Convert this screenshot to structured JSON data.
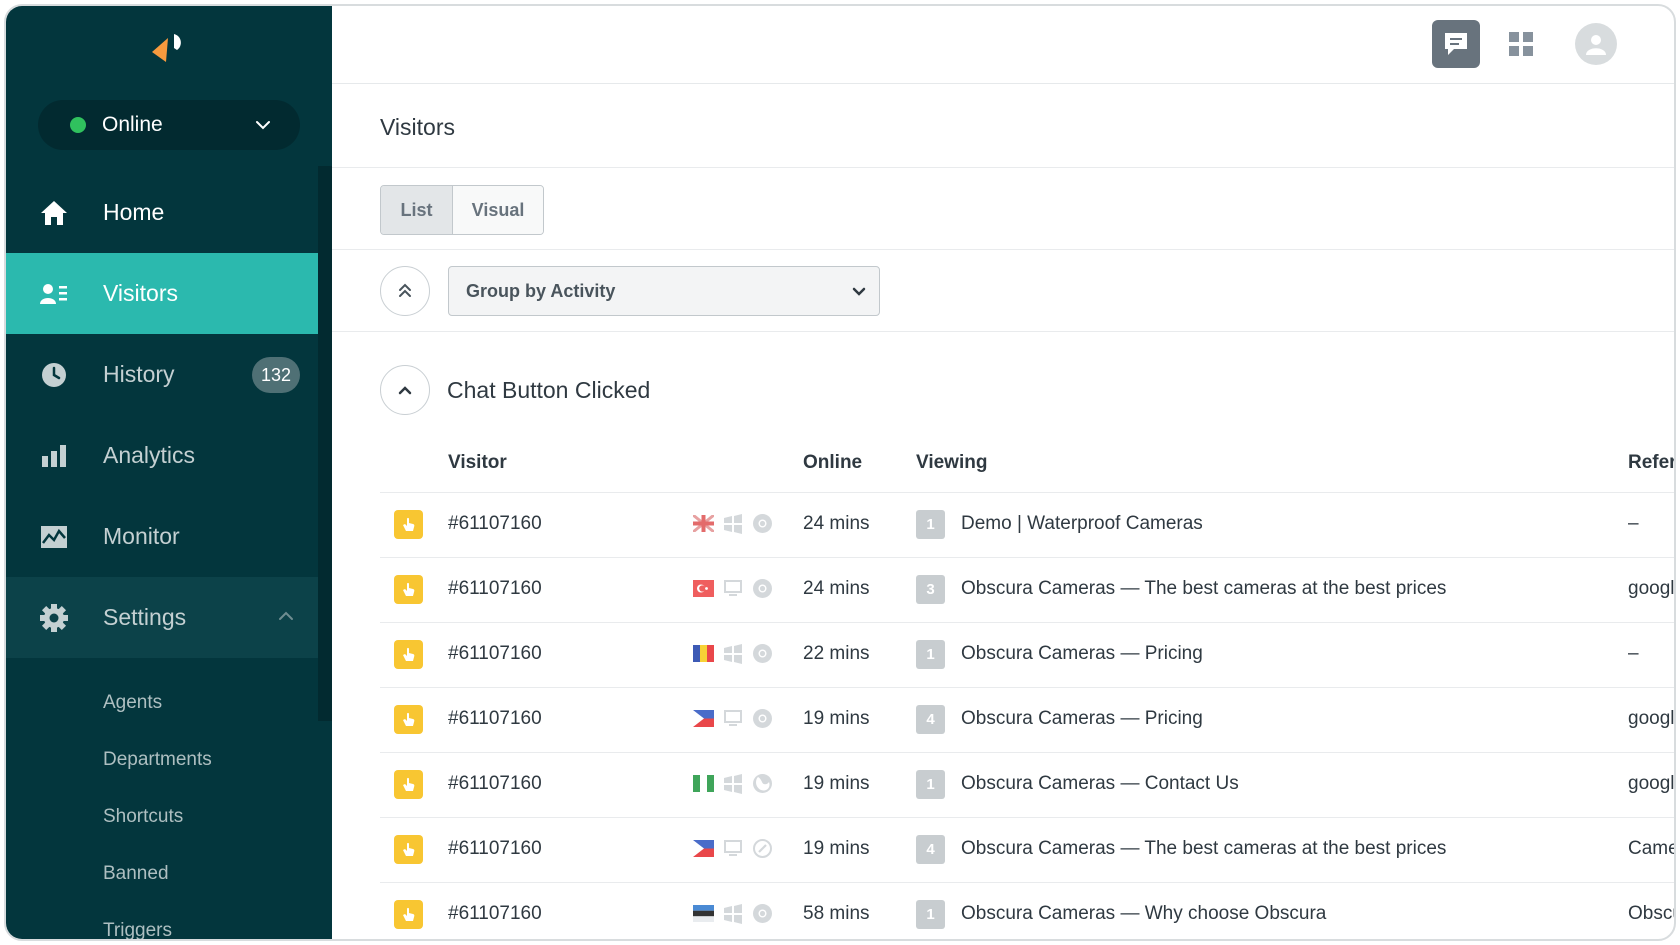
{
  "colors": {
    "sidebar_bg": "#03363d",
    "active_nav": "#2bb9ae",
    "online_dot": "#30c15e",
    "logo_orange": "#f79a3e",
    "activity_icon": "#f8c632"
  },
  "sidebar": {
    "status": "Online",
    "items": [
      {
        "label": "Home",
        "icon": "home-icon"
      },
      {
        "label": "Visitors",
        "icon": "visitors-icon"
      },
      {
        "label": "History",
        "icon": "clock-icon",
        "badge": "132"
      },
      {
        "label": "Analytics",
        "icon": "bar-chart-icon"
      },
      {
        "label": "Monitor",
        "icon": "monitor-chart-icon"
      },
      {
        "label": "Settings",
        "icon": "gear-icon"
      }
    ],
    "settings_sub": [
      "Agents",
      "Departments",
      "Shortcuts",
      "Banned",
      "Triggers"
    ]
  },
  "main": {
    "title": "Visitors",
    "view_tabs": [
      "List",
      "Visual"
    ],
    "active_view": "List",
    "group_by": "Group by Activity",
    "group_title": "Chat Button Clicked",
    "columns": [
      "Visitor",
      "Online",
      "Viewing",
      "Refer"
    ],
    "rows": [
      {
        "visitor": "#61107160",
        "flag": "uk",
        "os": "windows",
        "browser": "chrome",
        "online": "24 mins",
        "pages": "1",
        "viewing": "Demo | Waterproof Cameras",
        "referrer": "–"
      },
      {
        "visitor": "#61107160",
        "flag": "turkey",
        "os": "desktop",
        "browser": "chrome",
        "online": "24 mins",
        "pages": "3",
        "viewing": "Obscura Cameras — The best cameras at the best prices",
        "referrer": "google"
      },
      {
        "visitor": "#61107160",
        "flag": "romania",
        "os": "windows",
        "browser": "chrome",
        "online": "22 mins",
        "pages": "1",
        "viewing": "Obscura Cameras — Pricing",
        "referrer": "–"
      },
      {
        "visitor": "#61107160",
        "flag": "philippines",
        "os": "desktop",
        "browser": "chrome",
        "online": "19 mins",
        "pages": "4",
        "viewing": "Obscura Cameras — Pricing",
        "referrer": "google"
      },
      {
        "visitor": "#61107160",
        "flag": "nigeria",
        "os": "windows",
        "browser": "firefox",
        "online": "19 mins",
        "pages": "1",
        "viewing": "Obscura Cameras — Contact Us",
        "referrer": "google"
      },
      {
        "visitor": "#61107160",
        "flag": "philippines",
        "os": "desktop",
        "browser": "safari",
        "online": "19 mins",
        "pages": "4",
        "viewing": "Obscura Cameras — The best cameras at the best prices",
        "referrer": "Came"
      },
      {
        "visitor": "#61107160",
        "flag": "estonia",
        "os": "windows",
        "browser": "chrome",
        "online": "58 mins",
        "pages": "1",
        "viewing": "Obscura Cameras — Why choose Obscura",
        "referrer": "Obscu"
      }
    ]
  }
}
